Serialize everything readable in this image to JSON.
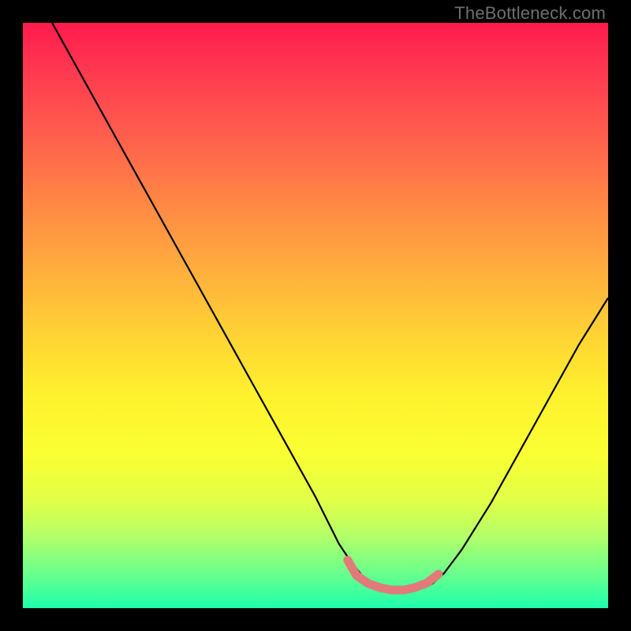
{
  "watermark": "TheBottleneck.com",
  "chart_data": {
    "type": "line",
    "title": "",
    "xlabel": "",
    "ylabel": "",
    "xlim": [
      0,
      100
    ],
    "ylim": [
      0,
      100
    ],
    "series": [
      {
        "name": "black-curve",
        "stroke": "#000000",
        "x": [
          5,
          10,
          15,
          20,
          25,
          30,
          35,
          40,
          45,
          50,
          54,
          56,
          58,
          60,
          62,
          64,
          66,
          68,
          70,
          72,
          75,
          80,
          85,
          90,
          95,
          100
        ],
        "values": [
          100,
          91,
          82,
          73,
          64,
          55,
          46,
          37,
          28,
          19,
          11,
          8,
          5.5,
          4,
          3.3,
          3,
          3,
          3.3,
          4.2,
          6,
          10,
          18,
          27,
          36,
          45,
          53
        ]
      },
      {
        "name": "salmon-segment",
        "stroke": "#e27a7a",
        "x": [
          55.5,
          57,
          59,
          61,
          63,
          65,
          67,
          69,
          71
        ],
        "values": [
          8.2,
          5.6,
          4.2,
          3.5,
          3.1,
          3.1,
          3.5,
          4.3,
          5.8
        ]
      }
    ]
  }
}
